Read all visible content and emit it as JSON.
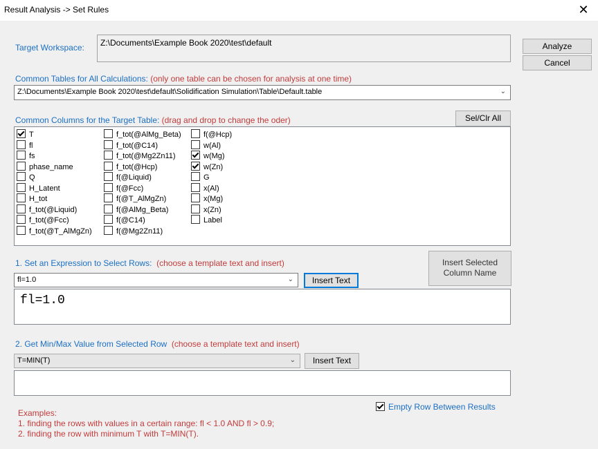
{
  "window": {
    "title": "Result Analysis -> Set Rules",
    "close_glyph": "✕"
  },
  "actions": {
    "analyze_label": "Analyze",
    "cancel_label": "Cancel"
  },
  "workspace": {
    "label": "Target Workspace:",
    "value": "Z:\\Documents\\Example Book 2020\\test\\default"
  },
  "tables": {
    "label": "Common Tables for All Calculations:",
    "note": "(only one table can be chosen for analysis at one time)",
    "selected": "Z:\\Documents\\Example Book 2020\\test\\default\\Solidification Simulation\\Table\\Default.table"
  },
  "columns": {
    "label": "Common Columns for the Target Table:",
    "note": "(drag and drop to change the oder)",
    "selclr_label": "Sel/Clr All",
    "col1": [
      {
        "label": "T",
        "checked": true
      },
      {
        "label": "fl",
        "checked": false
      },
      {
        "label": "fs",
        "checked": false
      },
      {
        "label": "phase_name",
        "checked": false
      },
      {
        "label": "Q",
        "checked": false
      },
      {
        "label": "H_Latent",
        "checked": false
      },
      {
        "label": "H_tot",
        "checked": false
      },
      {
        "label": "f_tot(@Liquid)",
        "checked": false
      },
      {
        "label": "f_tot(@Fcc)",
        "checked": false
      },
      {
        "label": "f_tot(@T_AlMgZn)",
        "checked": false
      }
    ],
    "col2": [
      {
        "label": "f_tot(@AlMg_Beta)",
        "checked": false
      },
      {
        "label": "f_tot(@C14)",
        "checked": false
      },
      {
        "label": "f_tot(@Mg2Zn11)",
        "checked": false
      },
      {
        "label": "f_tot(@Hcp)",
        "checked": false
      },
      {
        "label": "f(@Liquid)",
        "checked": false
      },
      {
        "label": "f(@Fcc)",
        "checked": false
      },
      {
        "label": "f(@T_AlMgZn)",
        "checked": false
      },
      {
        "label": "f(@AlMg_Beta)",
        "checked": false
      },
      {
        "label": "f(@C14)",
        "checked": false
      },
      {
        "label": "f(@Mg2Zn11)",
        "checked": false
      }
    ],
    "col3": [
      {
        "label": "f(@Hcp)",
        "checked": false
      },
      {
        "label": "w(Al)",
        "checked": false
      },
      {
        "label": "w(Mg)",
        "checked": true
      },
      {
        "label": "w(Zn)",
        "checked": true
      },
      {
        "label": "G",
        "checked": false
      },
      {
        "label": "x(Al)",
        "checked": false
      },
      {
        "label": "x(Mg)",
        "checked": false
      },
      {
        "label": "x(Zn)",
        "checked": false
      },
      {
        "label": "Label",
        "checked": false
      }
    ]
  },
  "select_rows": {
    "label": "1. Set an Expression to Select Rows:",
    "note": "(choose a template text and insert)",
    "template": "fl=1.0",
    "insert_label": "Insert Text",
    "expression": "fl=1.0"
  },
  "insert_column": {
    "label": "Insert Selected Column Name"
  },
  "minmax": {
    "label": "2. Get Min/Max Value from Selected Row",
    "note": "(choose a template text and insert)",
    "template": "T=MIN(T)",
    "insert_label": "Insert Text",
    "expression": ""
  },
  "empty_row": {
    "label": "Empty Row Between Results",
    "checked": true
  },
  "examples": {
    "title": "Examples:",
    "line1": "1. finding the rows with values in a certain range: fl < 1.0 AND fl > 0.9;",
    "line2": "2. finding the row with minimum T with T=MIN(T)."
  }
}
